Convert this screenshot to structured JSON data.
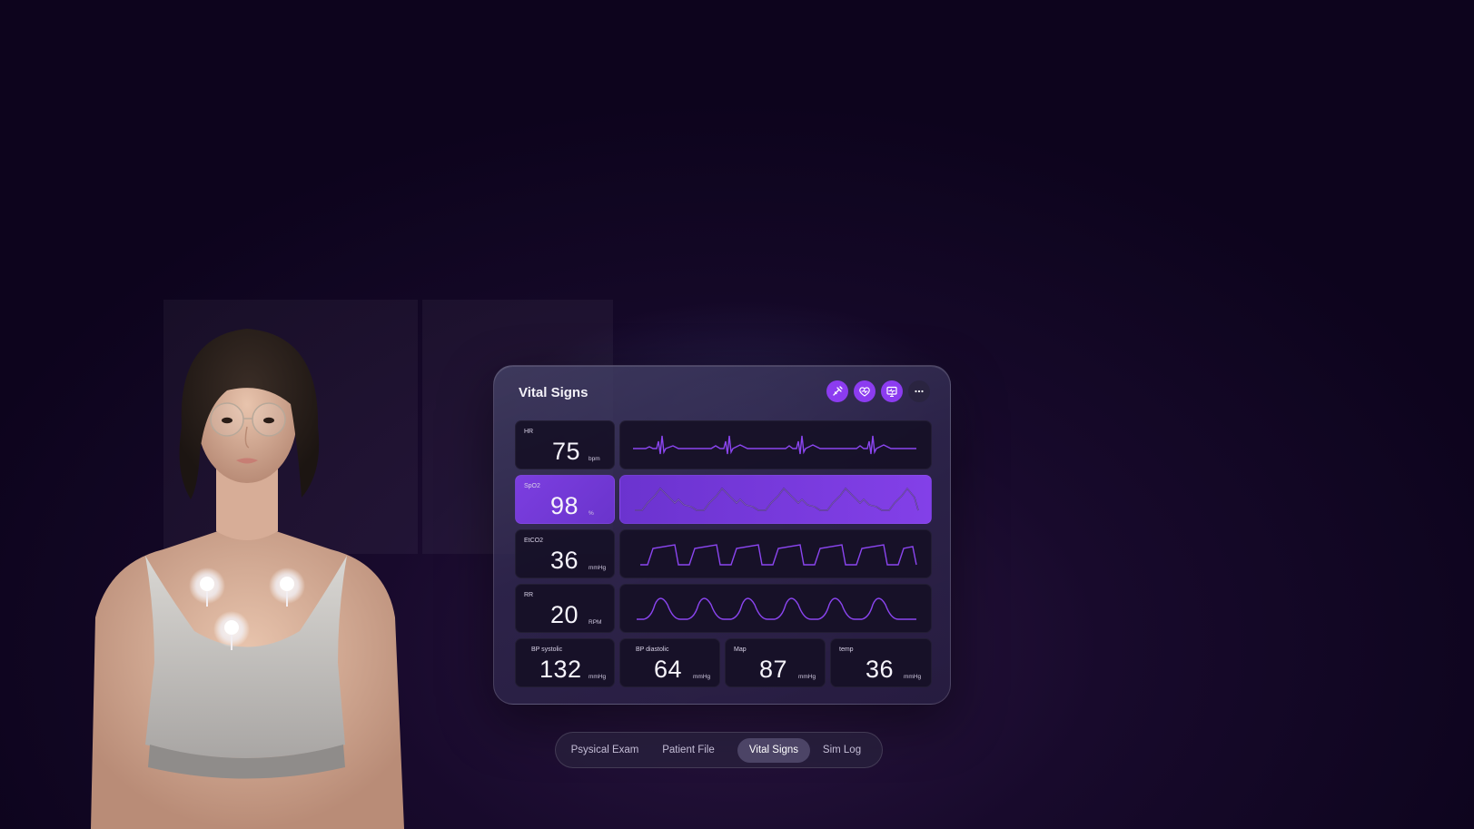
{
  "panel": {
    "title": "Vital Signs",
    "toolbar": [
      "syringe-icon",
      "heart-icon",
      "monitor-icon",
      "more-icon"
    ]
  },
  "vitals": {
    "hr": {
      "label": "HR",
      "value": "75",
      "unit": "bpm"
    },
    "spo2": {
      "label": "SpO2",
      "value": "98",
      "unit": "%"
    },
    "etco2": {
      "label": "EtCO2",
      "value": "36",
      "unit": "mmHg"
    },
    "rr": {
      "label": "RR",
      "value": "20",
      "unit": "RPM"
    },
    "bp_systolic": {
      "label": "BP systolic",
      "value": "132",
      "unit": "mmHg"
    },
    "bp_diastolic": {
      "label": "BP diastolic",
      "value": "64",
      "unit": "mmHg"
    },
    "map": {
      "label": "Map",
      "value": "87",
      "unit": "mmHg"
    },
    "temp": {
      "label": "temp",
      "value": "36",
      "unit": "mmHg"
    }
  },
  "tabs": [
    {
      "label": "Psysical Exam",
      "active": false
    },
    {
      "label": "Patient File",
      "active": false
    },
    {
      "label": "Vital Signs",
      "active": true
    },
    {
      "label": "Sim Log",
      "active": false
    }
  ],
  "colors": {
    "accent": "#8c3cf0",
    "highlight_card": "#7c3ee0",
    "waveform": "#8b45f0",
    "background": "#0d041d"
  }
}
